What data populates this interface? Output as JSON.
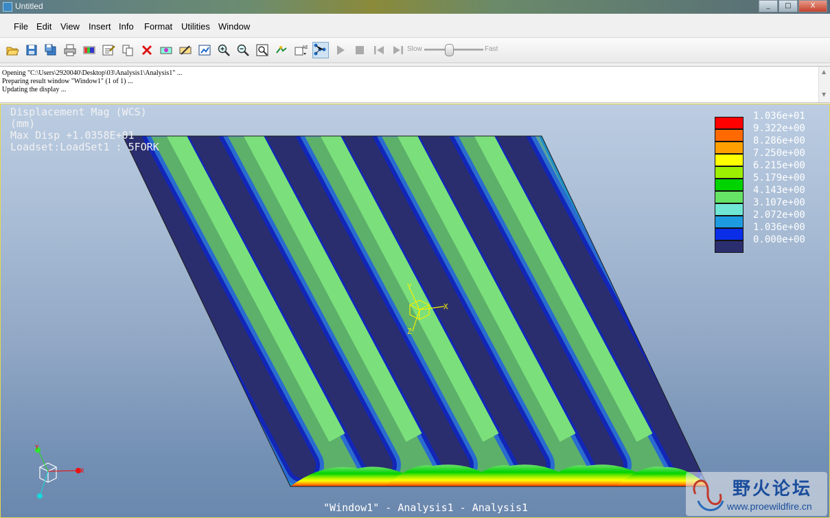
{
  "window": {
    "title": "Untitled",
    "minimize": "_",
    "maximize": "□",
    "close": "X"
  },
  "menu": [
    "File",
    "Edit",
    "View",
    "Insert",
    "Info",
    "Format",
    "Utilities",
    "Window"
  ],
  "toolbar": {
    "icons": [
      "open-icon",
      "save-icon",
      "save-as-icon",
      "print-icon",
      "edit-color-icon",
      "edit-definition-icon",
      "copy-icon",
      "delete-icon",
      "show-result-icon",
      "hide-result-icon",
      "update-icon",
      "zoom-in-icon",
      "zoom-out-icon",
      "refit-icon",
      "spin-icon",
      "view-options-icon",
      "select-icon",
      "play-icon",
      "stop-icon",
      "step-back-icon",
      "step-forward-icon"
    ],
    "speed_slow": "Slow",
    "speed_fast": "Fast",
    "speed_value": 0.42
  },
  "messages": [
    "Opening \"C:\\Users\\2920040\\Desktop\\03\\Analysis1\\Analysis1\" ...",
    "Preparing result window \"Window1\" (1 of 1) ...",
    "Updating the display ..."
  ],
  "viewport": {
    "header": [
      "Displacement Mag (WCS)",
      "(mm)",
      "Max Disp  +1.0358E+01",
      "Loadset:LoadSet1 : 5FORK"
    ],
    "legend": [
      {
        "value": "1.036e+01",
        "color": "#ff0000"
      },
      {
        "value": "9.322e+00",
        "color": "#ff6a00"
      },
      {
        "value": "8.286e+00",
        "color": "#ffa000"
      },
      {
        "value": "7.250e+00",
        "color": "#ffff00"
      },
      {
        "value": "6.215e+00",
        "color": "#9cef00"
      },
      {
        "value": "5.179e+00",
        "color": "#00d300"
      },
      {
        "value": "4.143e+00",
        "color": "#66e466"
      },
      {
        "value": "3.107e+00",
        "color": "#6fe7d4"
      },
      {
        "value": "2.072e+00",
        "color": "#1e9be0"
      },
      {
        "value": "1.036e+00",
        "color": "#0a2ee8"
      },
      {
        "value": "0.000e+00",
        "color": "#2b2e6e"
      }
    ],
    "footer": "\"Window1\" - Analysis1 - Analysis1",
    "axis_labels": {
      "x": "X",
      "y": "Y",
      "z": "Z"
    }
  },
  "watermark": {
    "name": "野火论坛",
    "url": "www.proewildfire.cn"
  }
}
